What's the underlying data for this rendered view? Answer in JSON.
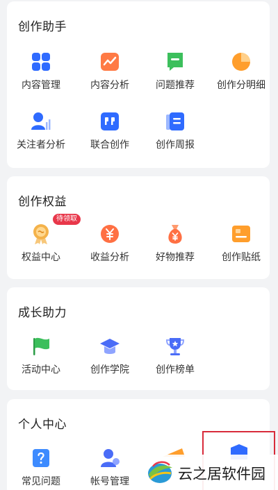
{
  "sections": [
    {
      "title": "创作助手",
      "items": [
        {
          "label": "内容管理",
          "icon": "grid-icon",
          "color": "#2f6bff"
        },
        {
          "label": "内容分析",
          "icon": "trend-chart-icon",
          "color": "#ff7a45"
        },
        {
          "label": "问题推荐",
          "icon": "question-flag-icon",
          "color": "#3cbf5c"
        },
        {
          "label": "创作分明细",
          "icon": "pie-chart-icon",
          "color": "#ff9e2c"
        },
        {
          "label": "关注者分析",
          "icon": "follower-chart-icon",
          "color": "#2f6bff"
        },
        {
          "label": "联合创作",
          "icon": "quote-icon",
          "color": "#2f6bff"
        },
        {
          "label": "创作周报",
          "icon": "report-doc-icon",
          "color": "#2f6bff"
        }
      ]
    },
    {
      "title": "创作权益",
      "badge": "待领取",
      "items": [
        {
          "label": "权益中心",
          "icon": "medal-icon",
          "color": "#f4b24a"
        },
        {
          "label": "收益分析",
          "icon": "yuan-coin-icon",
          "color": "#ff7043"
        },
        {
          "label": "好物推荐",
          "icon": "money-bag-icon",
          "color": "#ff7043"
        },
        {
          "label": "创作贴纸",
          "icon": "sticker-icon",
          "color": "#ff9e2c"
        }
      ]
    },
    {
      "title": "成长助力",
      "items": [
        {
          "label": "活动中心",
          "icon": "flag-icon",
          "color": "#3cbf5c"
        },
        {
          "label": "创作学院",
          "icon": "graduation-cap-icon",
          "color": "#4a6cf7"
        },
        {
          "label": "创作榜单",
          "icon": "trophy-icon",
          "color": "#4a6cf7"
        }
      ]
    },
    {
      "title": "个人中心",
      "items": [
        {
          "label": "常见问题",
          "icon": "help-doc-icon",
          "color": "#3d8bff"
        },
        {
          "label": "帐号管理",
          "icon": "account-user-icon",
          "color": "#4a6cf7"
        }
      ]
    }
  ],
  "watermark": {
    "text": "云之居软件园",
    "logo": "yunzhiju-logo"
  }
}
